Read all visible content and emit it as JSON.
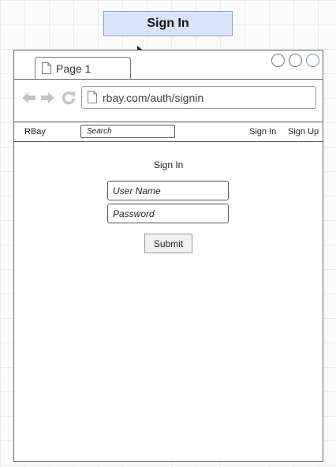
{
  "header": {
    "title": "Sign In"
  },
  "browser": {
    "tab_label": "Page 1",
    "url": "rbay.com/auth/signin"
  },
  "navbar": {
    "brand": "RBay",
    "search_placeholder": "Search",
    "sign_in": "Sign In",
    "sign_up": "Sign Up"
  },
  "form": {
    "heading": "Sign In",
    "username_placeholder": "User Name",
    "password_placeholder": "Password",
    "submit_label": "Submit"
  },
  "colors": {
    "title_bg": "#d9e4fb",
    "title_border": "#8a9ec6"
  }
}
